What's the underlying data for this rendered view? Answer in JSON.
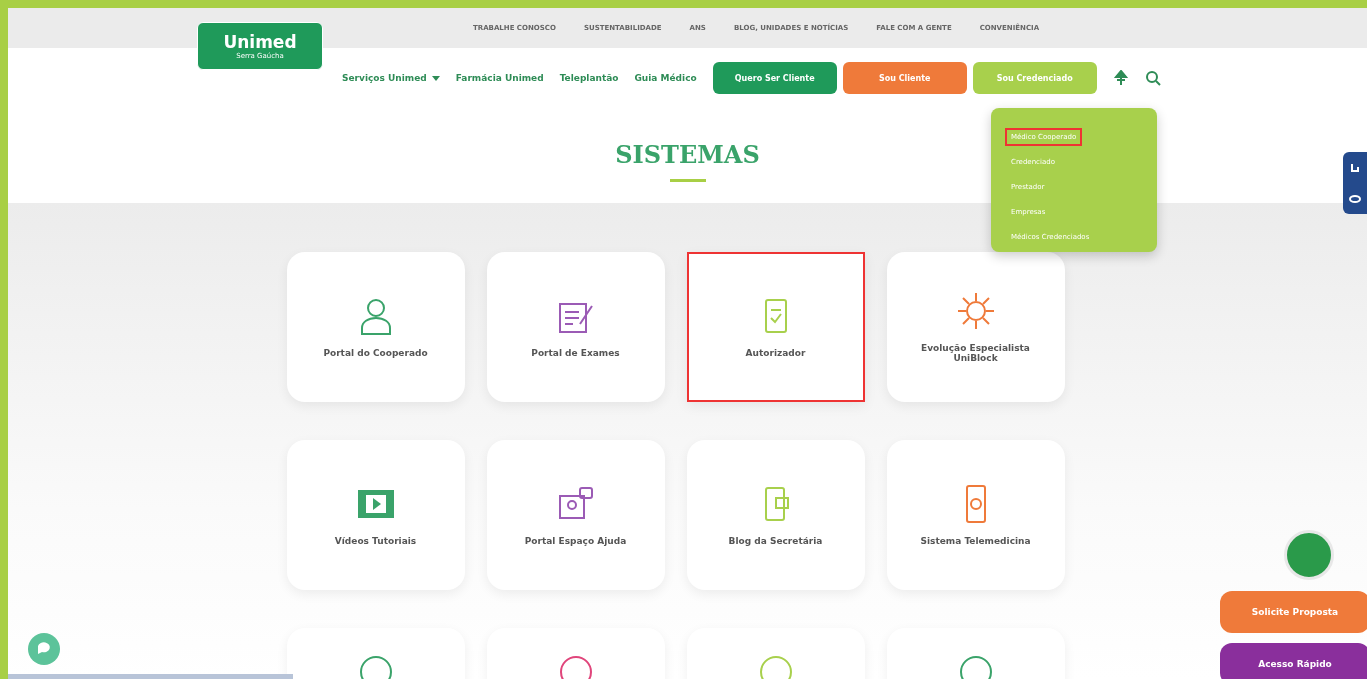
{
  "logo": {
    "name": "Unimed",
    "subtitle": "Serra Gaúcha"
  },
  "top_links": [
    "TRABALHE CONOSCO",
    "SUSTENTABILIDADE",
    "ANS",
    "BLOG, UNIDADES E NOTÍCIAS",
    "FALE COM A GENTE",
    "CONVENIÊNCIA"
  ],
  "main_nav": [
    {
      "label": "Serviços Unimed",
      "dropdown": true
    },
    {
      "label": "Farmácia Unimed",
      "dropdown": false
    },
    {
      "label": "Teleplantão",
      "dropdown": false
    },
    {
      "label": "Guia Médico",
      "dropdown": false
    }
  ],
  "nav_buttons": [
    {
      "label": "Quero Ser Cliente",
      "color": "#1f9a5a"
    },
    {
      "label": "Sou Cliente",
      "color": "#ef7a3a"
    },
    {
      "label": "Sou Credenciado",
      "color": "#a8d04c"
    }
  ],
  "dropdown": {
    "items": [
      {
        "label": "Médico Cooperado",
        "selected": true
      },
      {
        "label": "Credenciado",
        "selected": false
      },
      {
        "label": "Prestador",
        "selected": false
      },
      {
        "label": "Empresas",
        "selected": false
      },
      {
        "label": "Médicos Credenciados",
        "selected": false
      }
    ]
  },
  "page_title": "SISTEMAS",
  "cards": [
    {
      "kind": "person",
      "label": "Portal do Cooperado",
      "color": "#3aa36a",
      "selected": false
    },
    {
      "kind": "note",
      "label": "Portal de Exames",
      "color": "#9b5bb5",
      "selected": false
    },
    {
      "kind": "doc",
      "label": "Autorizador",
      "color": "#a8d04c",
      "selected": true
    },
    {
      "kind": "virus",
      "label": "Evolução Especialista UniBlock",
      "color": "#ef7a3a",
      "selected": false
    },
    {
      "kind": "film",
      "label": "Vídeos Tutoriais",
      "color": "#3aa36a",
      "selected": false
    },
    {
      "kind": "screen",
      "label": "Portal Espaço Ajuda",
      "color": "#9b5bb5",
      "selected": false
    },
    {
      "kind": "phone",
      "label": "Blog da Secretária",
      "color": "#a8d04c",
      "selected": false
    },
    {
      "kind": "mobile",
      "label": "Sistema Telemedicina",
      "color": "#ef7a3a",
      "selected": false
    },
    {
      "kind": "stub",
      "color": "#3aa36a",
      "selected": false
    },
    {
      "kind": "stub",
      "color": "#e0457b",
      "selected": false
    },
    {
      "kind": "stub",
      "color": "#a8d04c",
      "selected": false
    },
    {
      "kind": "stub",
      "color": "#3aa36a",
      "selected": false
    }
  ],
  "floating_buttons": [
    {
      "label": "Solicite Proposta",
      "color": "#ef7a3a"
    },
    {
      "label": "Acesso Rápido",
      "color": "#8a2f9c"
    }
  ]
}
